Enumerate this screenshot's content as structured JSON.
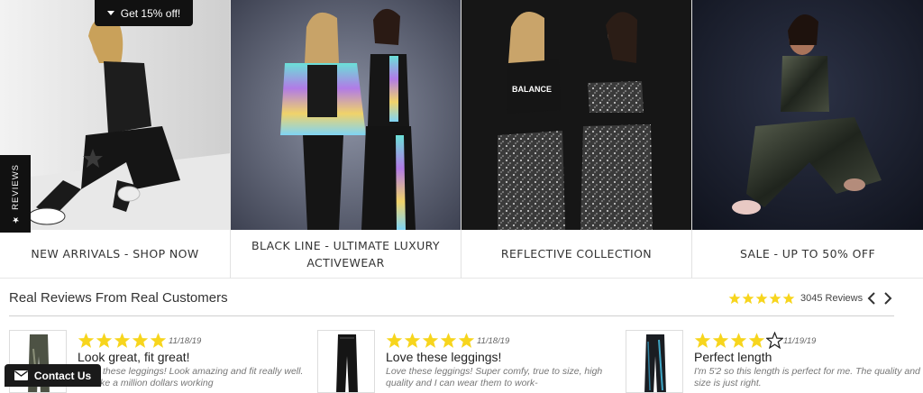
{
  "promo": {
    "label": "Get 15% off!"
  },
  "reviews_tab": {
    "label": "REVIEWS",
    "icon": "star-icon"
  },
  "tiles": [
    {
      "label": "NEW ARRIVALS - SHOP NOW"
    },
    {
      "label": "BLACK LINE - ULTIMATE LUXURY ACTIVEWEAR"
    },
    {
      "label": "REFLECTIVE COLLECTION"
    },
    {
      "label": "SALE - UP TO 50% OFF"
    }
  ],
  "reviews_section": {
    "title": "Real Reviews From Real Customers",
    "summary": {
      "rating": 5,
      "count_label": "3045 Reviews"
    },
    "items": [
      {
        "rating": 5,
        "date": "11/18/19",
        "title": "Look great, fit great!",
        "body": "I love these leggings! Look amazing and fit really well. Felt like a million dollars working"
      },
      {
        "rating": 5,
        "date": "11/18/19",
        "title": "Love these leggings!",
        "body": "Love these leggings! Super comfy, true to size, high quality and I can wear them to work-"
      },
      {
        "rating": 4,
        "date": "11/19/19",
        "title": "Perfect length",
        "body": "I'm 5'2 so this length is perfect for me. The quality and size is just right."
      }
    ]
  },
  "contact": {
    "label": "Contact Us",
    "icon": "envelope-icon"
  },
  "colors": {
    "star": "#f7d51d",
    "dark": "#111111"
  }
}
